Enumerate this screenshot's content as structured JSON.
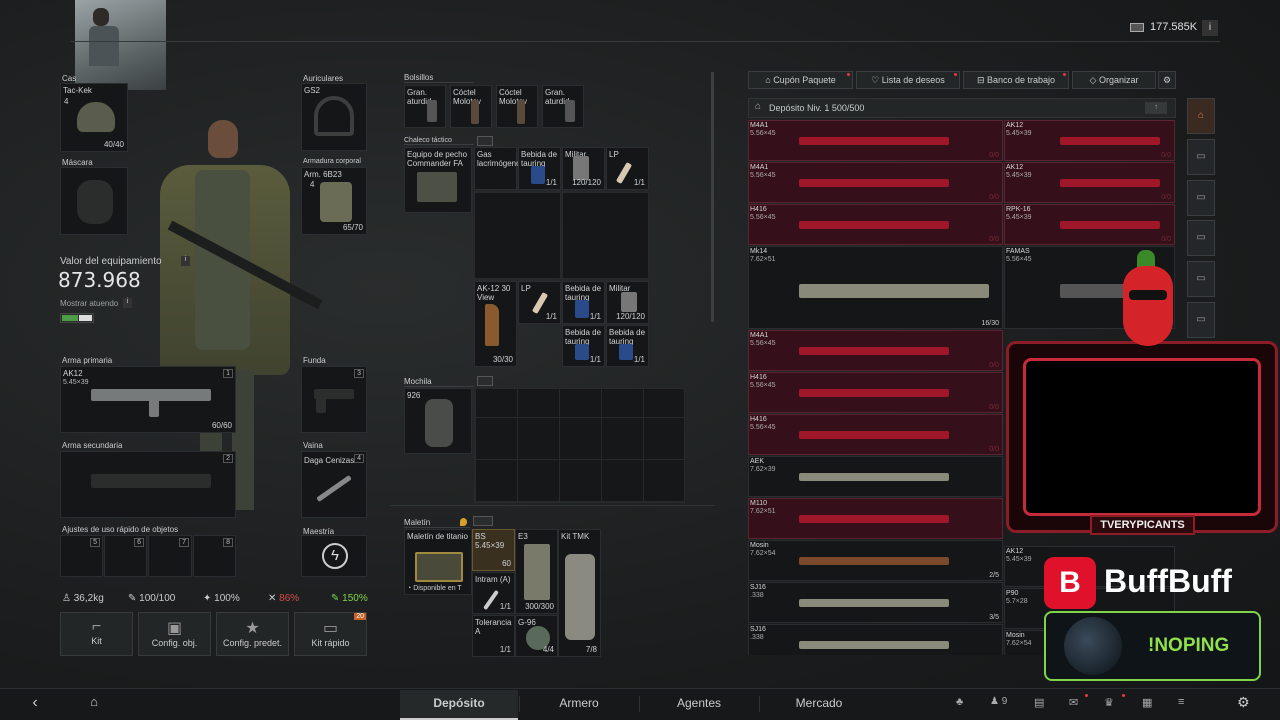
{
  "currency": {
    "amount": "177.585K",
    "info": "i"
  },
  "equipment": {
    "headwear_label": "Cas",
    "helmet": {
      "name": "Tac-Kek",
      "count": "40/40",
      "level": "4"
    },
    "earpiece_label": "Auriculares",
    "earpiece": {
      "name": "GS2"
    },
    "mask_label": "Máscara",
    "armor_label": "Armadura corporal",
    "armor": {
      "name": "Arm. 6B23",
      "count": "65/70",
      "level": "4"
    },
    "value_label": "Valor del equipamiento",
    "value": "873.968",
    "show_gear_label": "Mostrar atuendo",
    "primary_label": "Arma primaria",
    "primary": {
      "name": "AK12",
      "caliber": "5.45×39",
      "count": "60/60",
      "slot": "1"
    },
    "holster_label": "Funda",
    "holster_slot": "3",
    "secondary_label": "Arma secundaria",
    "secondary_slot": "2",
    "sheath_label": "Vaina",
    "sheath": {
      "name": "Daga Cenizas",
      "slot": "4"
    },
    "quick_label": "Ajustes de uso rápido de objetos",
    "quick_slots": [
      "5",
      "6",
      "7",
      "8"
    ],
    "mastery_label": "Maestría"
  },
  "stats": {
    "weight": "36,2kg",
    "hp": "100/100",
    "stamina": "100%",
    "hydration": "86%",
    "energy": "150%"
  },
  "quick_buttons": [
    {
      "label": "Kit",
      "icon": "rifle-icon"
    },
    {
      "label": "Config. obj.",
      "icon": "medkit-icon"
    },
    {
      "label": "Config. predet.",
      "icon": "star-icon"
    },
    {
      "label": "Kit rápido",
      "icon": "card-icon",
      "badge": "20"
    }
  ],
  "pockets": {
    "label": "Bolsillos",
    "items": [
      "Gran. aturdid",
      "Cóctel Molotov",
      "Cóctel Molotov",
      "Gran. aturdid"
    ]
  },
  "vest": {
    "label": "Chaleco táctico",
    "name": "Equipo de pecho Commander FA",
    "items": [
      {
        "name": "Gas lacrimógeno",
        "count": ""
      },
      {
        "name": "Bebida de tauring",
        "count": "1/1"
      },
      {
        "name": "Militar",
        "count": "120/120"
      },
      {
        "name": "LP",
        "count": "1/1"
      },
      {
        "name": "AK-12 30 View",
        "count": "30/30"
      },
      {
        "name": "LP",
        "count": "1/1"
      },
      {
        "name": "Bebida de tauring",
        "count": "1/1"
      },
      {
        "name": "Militar",
        "count": "120/120"
      },
      {
        "name": "Bebida de tauring",
        "count": "1/1"
      },
      {
        "name": "Bebida de tauring",
        "count": "1/1"
      }
    ]
  },
  "backpack": {
    "label": "Mochila",
    "name": "926"
  },
  "case": {
    "label": "Maletín",
    "name": "Maletín de titanio",
    "availability": "Disponible en T",
    "items": [
      {
        "name": "BS 5.45×39",
        "count": "60"
      },
      {
        "name": "E3",
        "count": "300/300"
      },
      {
        "name": "Kit TMK",
        "count": "7/8"
      },
      {
        "name": "Intram (A)",
        "count": "1/1"
      },
      {
        "name": "Tolerancia A",
        "count": "1/1"
      },
      {
        "name": "G-96",
        "count": "4/4"
      }
    ]
  },
  "stash": {
    "buttons": [
      "Cupón Paquete",
      "Lista de deseos",
      "Banco de trabajo",
      "Organizar"
    ],
    "title": "Depósito Niv. 1 500/500",
    "left_rows": [
      {
        "name": "M4A1",
        "caliber": "5.56×45",
        "count": "0/0",
        "red": true
      },
      {
        "name": "M4A1",
        "caliber": "5.56×45",
        "count": "0/0",
        "red": true
      },
      {
        "name": "H416",
        "caliber": "5.56×45",
        "count": "0/0",
        "red": true
      },
      {
        "name": "Mk14",
        "caliber": "7.62×51",
        "count": "16/30",
        "red": false
      },
      {
        "name": "M4A1",
        "caliber": "5.56×45",
        "count": "0/0",
        "red": true
      },
      {
        "name": "H416",
        "caliber": "5.56×45",
        "count": "0/0",
        "red": true
      },
      {
        "name": "H416",
        "caliber": "5.56×45",
        "count": "0/0",
        "red": true
      },
      {
        "name": "AEK",
        "caliber": "7.62×39",
        "count": "",
        "red": false
      },
      {
        "name": "M110",
        "caliber": "7.62×51",
        "count": "",
        "red": true
      },
      {
        "name": "Mosin",
        "caliber": "7.62×54",
        "count": "2/5",
        "red": false
      },
      {
        "name": "SJ16",
        "caliber": ".338",
        "count": "3/5",
        "red": false
      },
      {
        "name": "SJ16",
        "caliber": ".338",
        "count": "",
        "red": false
      }
    ],
    "right_rows": [
      {
        "name": "AK12",
        "caliber": "5.45×39",
        "count": "0/0"
      },
      {
        "name": "AK12",
        "caliber": "5.45×39",
        "count": "0/0"
      },
      {
        "name": "RPK-16",
        "caliber": "5.45×39",
        "count": "0/0"
      },
      {
        "name": "FAMAS",
        "caliber": "5.56×45",
        "count": ""
      }
    ],
    "lower_right": [
      {
        "name": "AK12",
        "caliber": "5.45×39"
      },
      {
        "name": "P90",
        "caliber": "5.7×28"
      },
      {
        "name": "Mosin",
        "caliber": "7.62×54"
      }
    ]
  },
  "overlay": {
    "streamer": "TVERYPICANTS",
    "brand": "BuffBuff",
    "nickname": "!NOPING"
  },
  "bottom_nav": {
    "tabs": [
      "Depósito",
      "Armero",
      "Agentes",
      "Mercado"
    ],
    "active": "Depósito",
    "friends_count": "9"
  },
  "colors": {
    "accent_red": "#a1172a",
    "accent_green": "#7fd44a",
    "brand_red": "#e0112b"
  }
}
